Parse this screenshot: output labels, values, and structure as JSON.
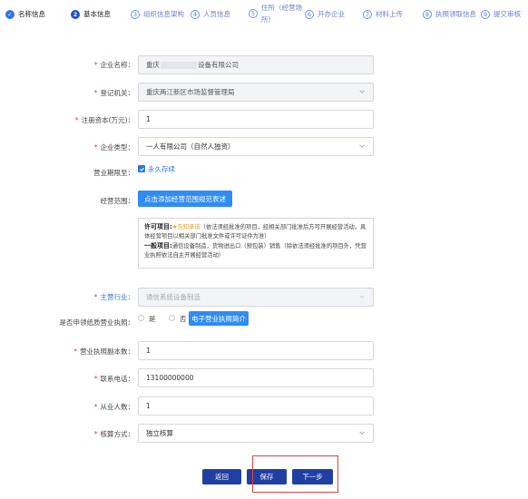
{
  "steps": [
    {
      "num": "✓",
      "label": "名称信息",
      "state": "done"
    },
    {
      "num": "2",
      "label": "基本信息",
      "state": "active"
    },
    {
      "num": "3",
      "label": "组织信息架构",
      "state": "todo"
    },
    {
      "num": "4",
      "label": "人员信息",
      "state": "todo"
    },
    {
      "num": "5",
      "label": "住所（经营场所）",
      "state": "todo"
    },
    {
      "num": "6",
      "label": "开办企业",
      "state": "todo"
    },
    {
      "num": "7",
      "label": "材料上传",
      "state": "todo"
    },
    {
      "num": "8",
      "label": "执照领取信息",
      "state": "todo"
    },
    {
      "num": "9",
      "label": "提交审核",
      "state": "todo"
    }
  ],
  "form": {
    "company_name": {
      "label": "企业名称：",
      "prefix": "重庆",
      "suffix": "设备有限公司"
    },
    "registration_authority": {
      "label": "登记机关：",
      "value": "重庆两江新区市场监督管理局"
    },
    "registered_capital": {
      "label": "注册资本(万元)：",
      "value": "1"
    },
    "company_type": {
      "label": "企业类型：",
      "value": "一人有限公司（自然人独资）"
    },
    "business_term": {
      "label": "营业期限至：",
      "checkbox_label": "永久存续",
      "checked": true
    },
    "business_scope": {
      "label": "经营范围：",
      "button_label": "点击添加经营范围规范表述",
      "licensed_title": "许可项目:",
      "licensed_tag": "★告知承诺",
      "licensed_text": "（依法须经批准的项目，经相关部门批准后方可开展经营活动，具体经营项目以相关部门批准文件或许可证件为准）",
      "general_title": "一般项目:",
      "general_text": "通信设备制造，货物进出口（预包装）销售（除依法须经批准的项目外，凭营业执照依法自主开展经营活动）"
    },
    "main_industry": {
      "label": "主营行业：",
      "value": "通信系统设备制造"
    },
    "paper_license": {
      "label": "是否申领纸质营业执照：",
      "yes": "是",
      "no": "否",
      "button_label": "电子营业执照简介"
    },
    "license_copies": {
      "label": "营业执照副本数：",
      "value": "1"
    },
    "phone": {
      "label": "联系电话：",
      "value": "13100000000"
    },
    "employees": {
      "label": "从业人数：",
      "value": "1"
    },
    "accounting": {
      "label": "核算方式：",
      "value": "独立核算"
    }
  },
  "buttons": {
    "back": "返回",
    "save": "保存",
    "next": "下一步"
  },
  "colors": {
    "primary": "#2f73e8",
    "dark_button": "#1f3fa3",
    "required": "#e23c3c",
    "highlight_box": "#e8423f"
  }
}
